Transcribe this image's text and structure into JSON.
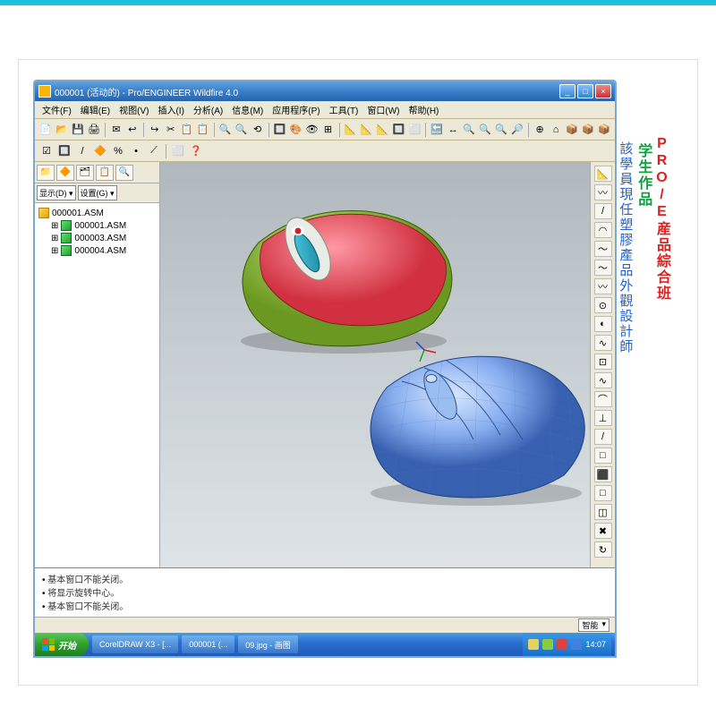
{
  "top_accent": "#1cc1dd",
  "window": {
    "title": "000001 (活动的) - Pro/ENGINEER Wildfire 4.0",
    "controls": {
      "min": "_",
      "max": "□",
      "close": "×"
    }
  },
  "menu": {
    "file": "文件(F)",
    "edit": "编辑(E)",
    "view": "视图(V)",
    "insert": "插入(I)",
    "analysis": "分析(A)",
    "info": "信息(M)",
    "app": "应用程序(P)",
    "tools": "工具(T)",
    "window": "窗口(W)",
    "help": "帮助(H)"
  },
  "toolbar_icons": [
    "📄",
    "📂",
    "💾",
    "🖨",
    "✉",
    "↩",
    "↪",
    "✂",
    "📋",
    "📋",
    "🔍",
    "🔍",
    "⟲",
    "🔲",
    "🎨",
    "👁",
    "⊞",
    "📐",
    "📐",
    "📐",
    "🔲",
    "⬜",
    "🔙",
    "↔",
    "🔍",
    "🔍",
    "🔍",
    "🔎",
    "⊕",
    "⌂",
    "📦",
    "📦",
    "📦"
  ],
  "toolbar2_icons": [
    "☑",
    "🔲",
    "/",
    "🔶",
    "%",
    "•",
    "⟋",
    "⬜",
    "❓"
  ],
  "left_panel": {
    "tabs": [
      "📁",
      "🔶",
      "🗂",
      "📋",
      "🔍"
    ],
    "filter_show": "显示(D) ▾",
    "filter_set": "设置(G) ▾",
    "tree": {
      "root": "000001.ASM",
      "items": [
        "000001.ASM",
        "000003.ASM",
        "000004.ASM"
      ]
    }
  },
  "right_tools": [
    "📐",
    "〰",
    "/",
    "◠",
    "〜",
    "〜",
    "〰",
    "⊙",
    "◐",
    "∿",
    "⊡",
    "∿",
    "⌒",
    "⊥",
    "/",
    "□",
    "⬛",
    "□",
    "◫",
    "✖",
    "↻"
  ],
  "messages": {
    "m1": "基本窗口不能关闭。",
    "m2": "将显示旋转中心。",
    "m3": "基本窗口不能关闭。"
  },
  "status": {
    "mode": "智能"
  },
  "taskbar": {
    "start": "开始",
    "items": [
      "CorelDRAW X3 - [...",
      "000001 (...",
      "09.jpg - 画图"
    ],
    "time": "14:07"
  },
  "side": {
    "title_red": "PRO/E産品綜合班",
    "title_green": "学生作品",
    "caption_blue": "該學員現任塑膠產品外觀設計師"
  }
}
